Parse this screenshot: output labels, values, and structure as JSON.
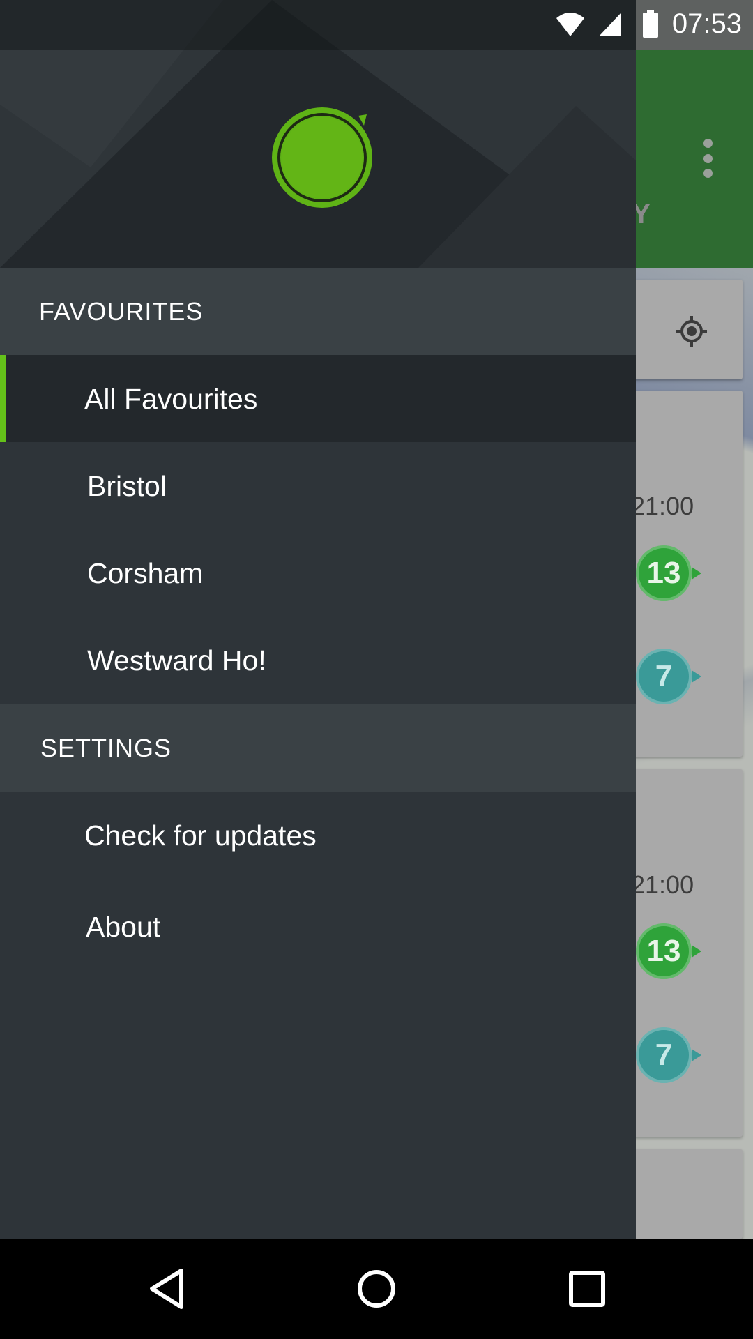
{
  "status_bar": {
    "time": "07:53"
  },
  "background_app": {
    "tab_partial_label": "AY",
    "cards": [
      {
        "time": "21:00",
        "badges": [
          "13",
          "7"
        ]
      },
      {
        "time": "21:00",
        "badges": [
          "13",
          "7"
        ]
      }
    ]
  },
  "drawer": {
    "sections": [
      {
        "header": "FAVOURITES",
        "items": [
          {
            "label": "All Favourites",
            "selected": true
          },
          {
            "label": "Bristol"
          },
          {
            "label": "Corsham"
          },
          {
            "label": "Westward Ho!"
          }
        ]
      },
      {
        "header": "SETTINGS",
        "items": [
          {
            "label": "Check for updates"
          },
          {
            "label": "About"
          }
        ]
      }
    ]
  },
  "colors": {
    "accent": "#64c11a",
    "drawer_bg": "#2e3439",
    "section_bg": "#3a4145",
    "selected_bg": "#23282c",
    "toolbar": "#2e6b31",
    "badge_green": "#2fa33a",
    "badge_teal": "#3a9a98"
  },
  "icons": [
    "wifi-icon",
    "signal-icon",
    "battery-icon",
    "overflow-menu-icon",
    "my-location-icon",
    "app-logo-icon",
    "back-icon",
    "home-icon",
    "recents-icon"
  ]
}
